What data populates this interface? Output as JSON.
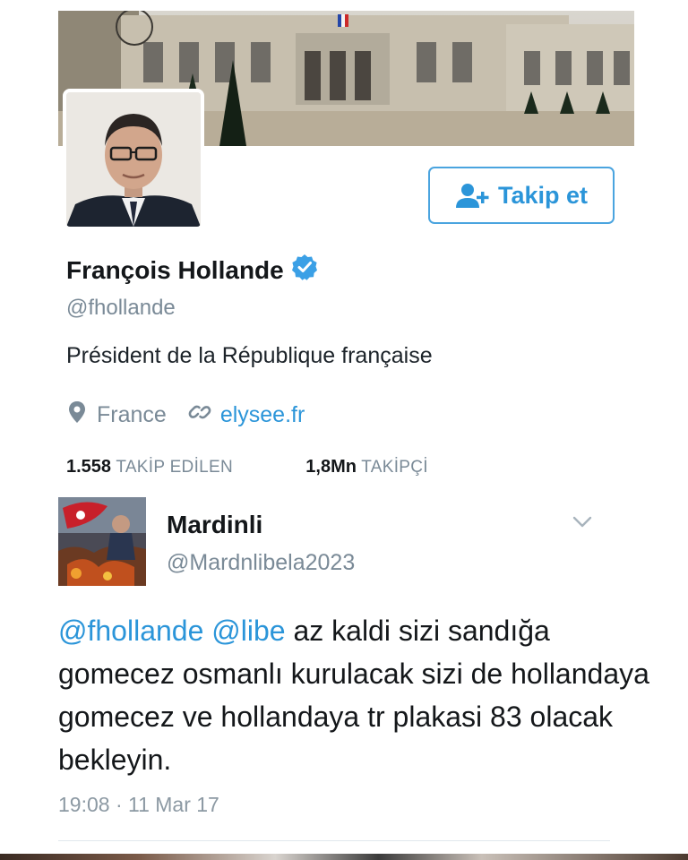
{
  "profile": {
    "name": "François Hollande",
    "handle": "@fhollande",
    "bio": "Président de la République française",
    "location": "France",
    "website": "elysee.fr",
    "follow_button": "Takip et",
    "following_count": "1.558",
    "following_label": "TAKİP EDİLEN",
    "followers_count": "1,8Mn",
    "followers_label": "TAKİPÇİ"
  },
  "tweet": {
    "author_name": "Mardinli",
    "author_handle": "@Mardnlibela2023",
    "mention_1": "@fhollande",
    "mention_2": "@libe",
    "body": " az kaldi sizi sandığa gomecez osmanlı kurulacak sizi de hollandaya gomecez ve hollandaya tr plakasi 83 olacak bekleyin.",
    "timestamp": "19:08 · 11 Mar 17"
  },
  "icons": {
    "verified": "verified-badge-icon",
    "location": "location-pin-icon",
    "link": "link-icon",
    "follow": "add-user-icon",
    "menu": "chevron-down-icon"
  },
  "colors": {
    "accent": "#2b95d9",
    "muted": "#7a8a97",
    "verified": "#3ba0e6"
  }
}
